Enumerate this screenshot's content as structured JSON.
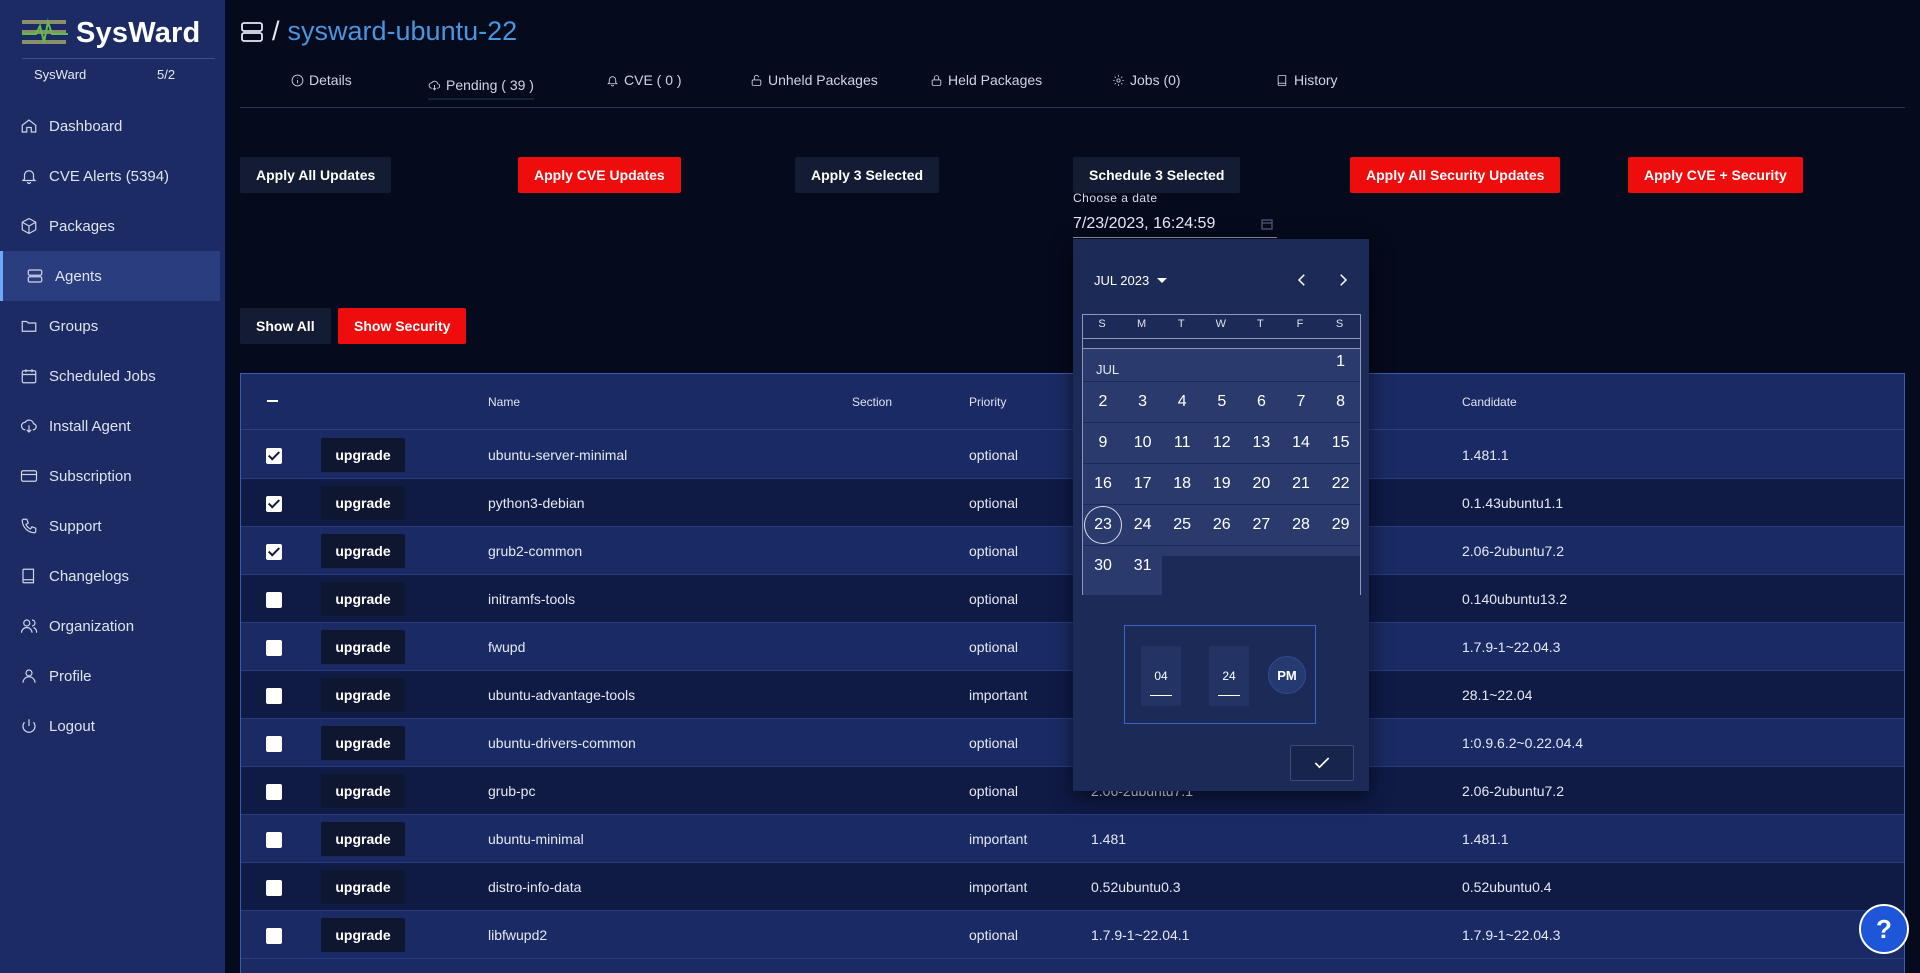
{
  "app": {
    "logo_text": "SysWard",
    "org_name": "SysWard",
    "version": "5/2"
  },
  "sidebar": {
    "items": [
      {
        "label": "Dashboard",
        "icon": "home-icon"
      },
      {
        "label": "CVE Alerts (5394)",
        "icon": "bell-icon"
      },
      {
        "label": "Packages",
        "icon": "box-icon"
      },
      {
        "label": "Agents",
        "icon": "server-icon",
        "active": true
      },
      {
        "label": "Groups",
        "icon": "folder-icon"
      },
      {
        "label": "Scheduled Jobs",
        "icon": "calendar-icon"
      },
      {
        "label": "Install Agent",
        "icon": "cloud-download-icon"
      },
      {
        "label": "Subscription",
        "icon": "credit-card-icon"
      },
      {
        "label": "Support",
        "icon": "phone-icon"
      },
      {
        "label": "Changelogs",
        "icon": "book-icon"
      },
      {
        "label": "Organization",
        "icon": "users-icon"
      },
      {
        "label": "Profile",
        "icon": "user-icon"
      },
      {
        "label": "Logout",
        "icon": "power-icon"
      }
    ]
  },
  "header": {
    "separator": "/",
    "agent_name": "sysward-ubuntu-22"
  },
  "tabs": [
    {
      "label": "Details",
      "icon": "info-icon"
    },
    {
      "label": "Pending ( 39 )",
      "icon": "cloud-download-icon"
    },
    {
      "label": "CVE ( 0 )",
      "icon": "bell-icon"
    },
    {
      "label": "Unheld Packages",
      "icon": "unlock-icon"
    },
    {
      "label": "Held Packages",
      "icon": "lock-icon"
    },
    {
      "label": "Jobs (0)",
      "icon": "gear-icon"
    },
    {
      "label": "History",
      "icon": "book-icon"
    }
  ],
  "actions": {
    "apply_all": "Apply All Updates",
    "apply_cve": "Apply CVE Updates",
    "apply_selected": "Apply 3 Selected",
    "schedule_selected": "Schedule 3 Selected",
    "apply_security": "Apply All Security Updates",
    "apply_cve_security": "Apply CVE + Security",
    "show_all": "Show All",
    "show_security": "Show Security"
  },
  "date_field": {
    "label": "Choose a date",
    "value": "7/23/2023, 16:24:59"
  },
  "datepicker": {
    "month_label": "JUL 2023",
    "weekdays": [
      "S",
      "M",
      "T",
      "W",
      "T",
      "F",
      "S"
    ],
    "month_row_label": "JUL",
    "weeks": [
      [
        "",
        "",
        "",
        "",
        "",
        "",
        "1"
      ],
      [
        "2",
        "3",
        "4",
        "5",
        "6",
        "7",
        "8"
      ],
      [
        "9",
        "10",
        "11",
        "12",
        "13",
        "14",
        "15"
      ],
      [
        "16",
        "17",
        "18",
        "19",
        "20",
        "21",
        "22"
      ],
      [
        "23",
        "24",
        "25",
        "26",
        "27",
        "28",
        "29"
      ],
      [
        "30",
        "31",
        "",
        "",
        "",
        "",
        ""
      ]
    ],
    "selected_day": "23",
    "hour": "04",
    "minute": "24",
    "colon": ":",
    "ampm": "PM"
  },
  "table": {
    "columns": {
      "name": "Name",
      "section": "Section",
      "priority": "Priority",
      "candidate": "Candidate"
    },
    "upgrade_label": "upgrade",
    "rows": [
      {
        "checked": true,
        "name": "ubuntu-server-minimal",
        "section": "",
        "priority": "optional",
        "installed": "",
        "candidate": "1.481.1"
      },
      {
        "checked": true,
        "name": "python3-debian",
        "section": "",
        "priority": "optional",
        "installed": "",
        "candidate": "0.1.43ubuntu1.1"
      },
      {
        "checked": true,
        "name": "grub2-common",
        "section": "",
        "priority": "optional",
        "installed": "",
        "candidate": "2.06-2ubuntu7.2"
      },
      {
        "checked": false,
        "name": "initramfs-tools",
        "section": "",
        "priority": "optional",
        "installed": "",
        "candidate": "0.140ubuntu13.2"
      },
      {
        "checked": false,
        "name": "fwupd",
        "section": "",
        "priority": "optional",
        "installed": "",
        "candidate": "1.7.9-1~22.04.3"
      },
      {
        "checked": false,
        "name": "ubuntu-advantage-tools",
        "section": "",
        "priority": "important",
        "installed": "",
        "candidate": "28.1~22.04"
      },
      {
        "checked": false,
        "name": "ubuntu-drivers-common",
        "section": "",
        "priority": "optional",
        "installed": "",
        "candidate": "1:0.9.6.2~0.22.04.4"
      },
      {
        "checked": false,
        "name": "grub-pc",
        "section": "",
        "priority": "optional",
        "installed": "2.06-2ubuntu7.1",
        "candidate": "2.06-2ubuntu7.2"
      },
      {
        "checked": false,
        "name": "ubuntu-minimal",
        "section": "",
        "priority": "important",
        "installed": "1.481",
        "candidate": "1.481.1"
      },
      {
        "checked": false,
        "name": "distro-info-data",
        "section": "",
        "priority": "important",
        "installed": "0.52ubuntu0.3",
        "candidate": "0.52ubuntu0.4"
      },
      {
        "checked": false,
        "name": "libfwupd2",
        "section": "",
        "priority": "optional",
        "installed": "1.7.9-1~22.04.1",
        "candidate": "1.7.9-1~22.04.3"
      }
    ]
  },
  "help_button": "?",
  "colors": {
    "sidebar_bg": "#1c2b63",
    "page_bg": "#050a1c",
    "accent_blue": "#4a95e0",
    "danger_red": "#ee0c0c"
  }
}
